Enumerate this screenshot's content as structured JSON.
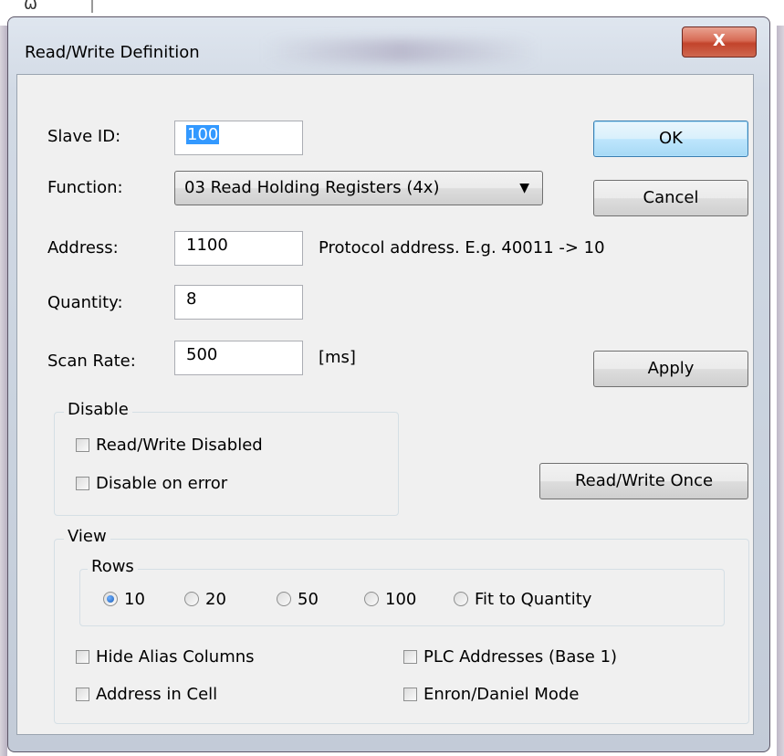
{
  "window": {
    "title": "Read/Write Definition",
    "close_glyph": "X"
  },
  "fields": {
    "slave_id": {
      "label": "Slave ID:",
      "value": "100"
    },
    "function": {
      "label": "Function:",
      "value": "03 Read Holding Registers (4x)",
      "arrow": "▼"
    },
    "address": {
      "label": "Address:",
      "value": "1100",
      "hint": "Protocol address. E.g. 40011 -> 10"
    },
    "quantity": {
      "label": "Quantity:",
      "value": "8"
    },
    "scan_rate": {
      "label": "Scan Rate:",
      "value": "500",
      "unit": "[ms]"
    }
  },
  "buttons": {
    "ok": "OK",
    "cancel": "Cancel",
    "apply": "Apply",
    "read_write_once": "Read/Write Once"
  },
  "disable": {
    "title": "Disable",
    "read_write_disabled": "Read/Write Disabled",
    "disable_on_error": "Disable on error"
  },
  "view": {
    "title": "View",
    "rows": {
      "title": "Rows",
      "options": [
        "10",
        "20",
        "50",
        "100",
        "Fit to Quantity"
      ],
      "selected": "10"
    },
    "hide_alias_columns": "Hide Alias Columns",
    "address_in_cell": "Address in Cell",
    "plc_addresses": "PLC Addresses (Base 1)",
    "enron_daniel_mode": "Enron/Daniel Mode"
  }
}
